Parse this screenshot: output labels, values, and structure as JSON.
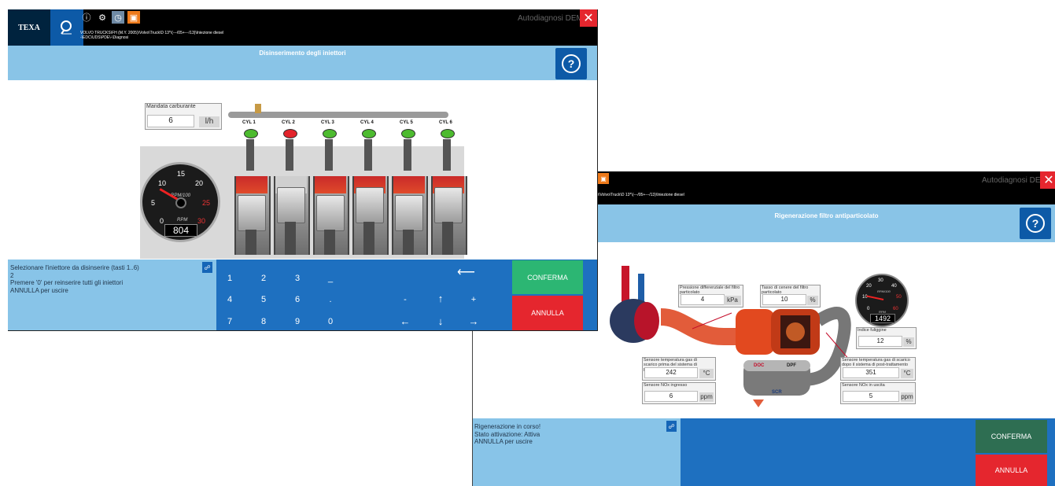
{
  "window_injectors": {
    "logo_text": "TEXA",
    "breadcrumb_line1": "VOLVO TRUCKS\\FH (M.Y. 2005)\\Volvo\\Truck\\D 13*\\(---/05+---/13)\\Iniezione diesel",
    "breadcrumb_line2": "-\\EDC\\UDS\\PDE\\-\\Diagnosi",
    "app_name": "Autodiagnosi DEMO",
    "close_glyph": "✕",
    "page_title": "Disinserimento degli iniettori",
    "fuel_gauge": {
      "label": "Mandata carburante",
      "value": "6",
      "unit": "l/h"
    },
    "cylinders": [
      {
        "label": "CYL 1",
        "state": "green"
      },
      {
        "label": "CYL 2",
        "state": "red"
      },
      {
        "label": "CYL 3",
        "state": "green"
      },
      {
        "label": "CYL 4",
        "state": "green"
      },
      {
        "label": "CYL 5",
        "state": "green"
      },
      {
        "label": "CYL 6",
        "state": "green"
      }
    ],
    "tachometer": {
      "ticks": [
        "0",
        "5",
        "10",
        "15",
        "20",
        "25",
        "30"
      ],
      "unit_label": "RPM/100",
      "rpm_label": "RPM",
      "rpm_value": "804",
      "rpm_reading": 804
    },
    "instructions": [
      "Selezionare l'iniettore da disinserire (tasti 1..6)",
      "2",
      "Premere '0' per reinserire tutti gli iniettori",
      "ANNULLA per uscire"
    ],
    "keypad": {
      "row1": [
        "1",
        "2",
        "3",
        "_"
      ],
      "row2": [
        "4",
        "5",
        "6",
        "."
      ],
      "row3": [
        "7",
        "8",
        "9",
        "0"
      ],
      "nav_row1_backspace": "⟵",
      "nav_row2": [
        "-",
        "↑",
        "+"
      ],
      "nav_row3": [
        "←",
        "↓",
        "→"
      ]
    },
    "confirm_label": "CONFERMA",
    "cancel_label": "ANNULLA"
  },
  "window_dpf": {
    "breadcrumb_line1": "i\\Volvo\\Truck\\D 13*\\(---/05+---/13)\\Iniezione diesel",
    "app_name": "Autodiagnosi DEMO",
    "close_glyph": "✕",
    "page_title": "Rigenerazione filtro antiparticolato",
    "gauges": {
      "pressure": {
        "label": "Pressione differenziale del filtro particolato",
        "value": "4",
        "unit": "kPa"
      },
      "ash": {
        "label": "Tasso di cenere del filtro particolato",
        "value": "10",
        "unit": "%"
      },
      "soot": {
        "label": "Indice fuliggine",
        "value": "12",
        "unit": "%"
      },
      "temp_before": {
        "label": "Sensore temperatura gas di scarico prima del sistema di post-trattamento",
        "value": "242",
        "unit": "°C"
      },
      "temp_after": {
        "label": "Sensore temperatura gas di scarico dopo il sistema di post-trattamento",
        "value": "351",
        "unit": "°C"
      },
      "nox_in": {
        "label": "Sensore NOx ingresso",
        "value": "6",
        "unit": "ppm"
      },
      "nox_out": {
        "label": "Sensore NOx in uscita",
        "value": "5",
        "unit": "ppm"
      }
    },
    "component_labels": {
      "doc": "DOC",
      "dpf": "DPF",
      "scr": "SCR"
    },
    "tachometer": {
      "ticks": [
        "0",
        "10",
        "20",
        "30",
        "40",
        "50",
        "60"
      ],
      "unit_label": "RPM/100",
      "rpm_label": "RPM",
      "rpm_value": "1492",
      "rpm_reading": 1492
    },
    "instructions": [
      "Rigenerazione in corso!",
      "Stato attivazione: Attiva",
      "ANNULLA per uscire"
    ],
    "confirm_label": "CONFERMA",
    "cancel_label": "ANNULLA"
  },
  "colors": {
    "accent_blue": "#0d5aa7",
    "panel_light_blue": "#88c4e8",
    "keypad_blue": "#1e70c0",
    "confirm_green": "#2cb673",
    "confirm_disabled": "#2e6e52",
    "cancel_red": "#e5262e"
  }
}
